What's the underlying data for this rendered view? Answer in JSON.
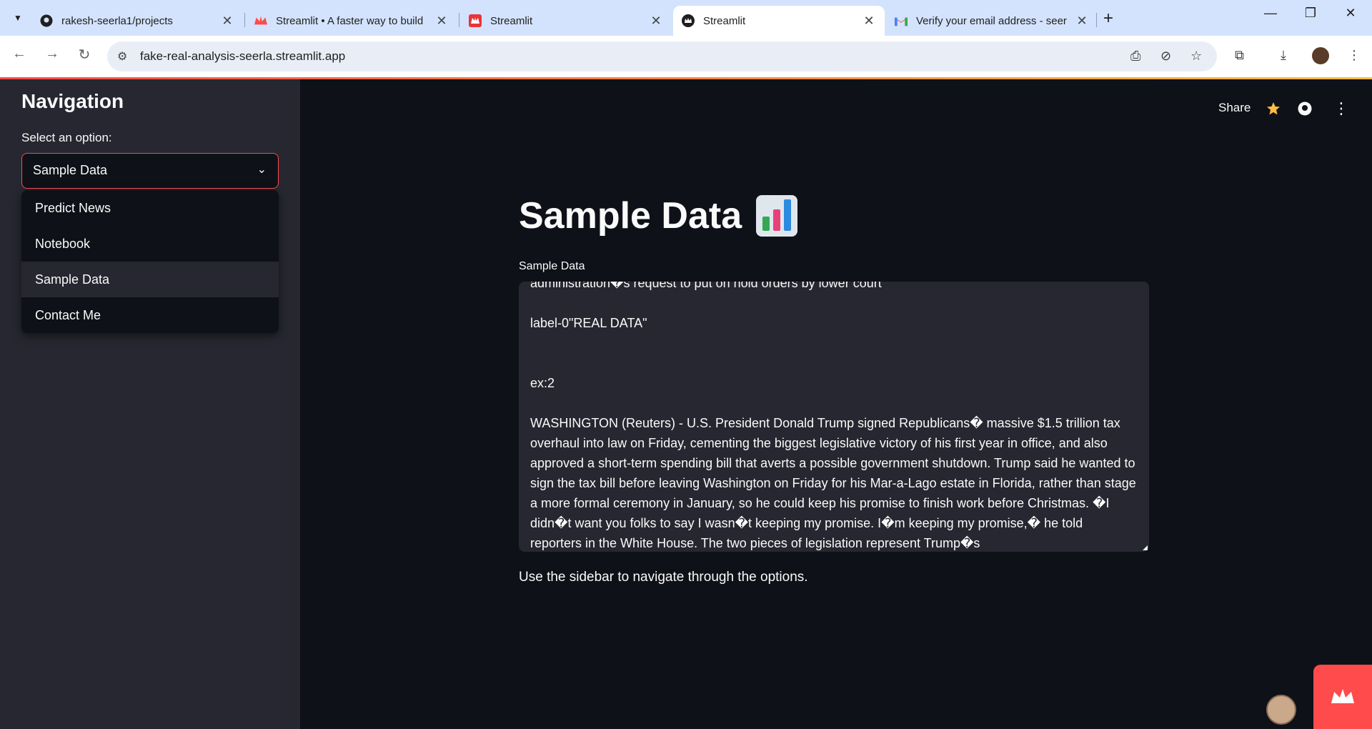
{
  "browser": {
    "tabs": [
      {
        "label": "rakesh-seerla1/projects",
        "icon": "github-icon",
        "active": false
      },
      {
        "label": "Streamlit • A faster way to build",
        "icon": "streamlit-crown-icon",
        "active": false
      },
      {
        "label": "Streamlit",
        "icon": "streamlit-red-icon",
        "active": false
      },
      {
        "label": "Streamlit",
        "icon": "streamlit-crown-icon",
        "active": true
      },
      {
        "label": "Verify your email address - seer",
        "icon": "gmail-icon",
        "active": false
      }
    ],
    "url": "fake-real-analysis-seerla.streamlit.app"
  },
  "sidebar": {
    "title": "Navigation",
    "select_label": "Select an option:",
    "selected": "Sample Data",
    "options": [
      "Predict News",
      "Notebook",
      "Sample Data",
      "Contact Me"
    ],
    "highlighted": "Sample Data"
  },
  "header": {
    "share_label": "Share"
  },
  "main": {
    "title": "Sample Data",
    "title_emoji": "bar-chart-emoji",
    "textarea_label": "Sample Data",
    "textarea_text": "administration�s request to put on hold orders by lower court\n\nlabel-0\"REAL DATA\"\n\n\nex:2\n\nWASHINGTON (Reuters) - U.S. President Donald Trump signed Republicans� massive $1.5 trillion tax overhaul into law on Friday, cementing the biggest legislative victory of his first year in office, and also approved a short-term spending bill that averts a possible government shutdown. Trump said he wanted to sign the tax bill before leaving Washington on Friday for his Mar-a-Lago estate in Florida, rather than stage a more formal ceremony in January, so he could keep his promise to finish work before Christmas. �I didn�t want you folks to say I wasn�t keeping my promise. I�m keeping my promise,� he told reporters in the White House. The two pieces of legislation represent Trump�s",
    "caption": "Use the sidebar to navigate through the options."
  },
  "colors": {
    "accent": "#ff4b4b",
    "background": "#0e1117",
    "sidebar": "#262730"
  }
}
